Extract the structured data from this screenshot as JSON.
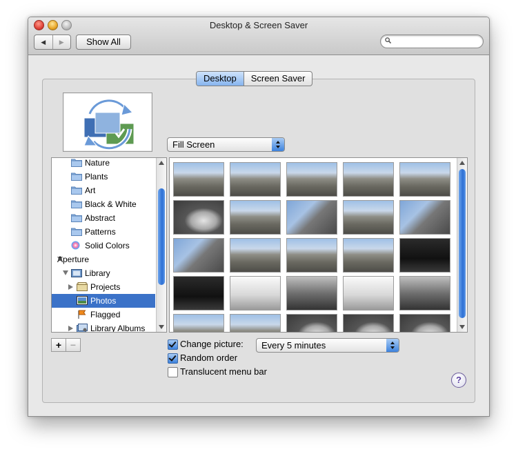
{
  "window": {
    "title": "Desktop & Screen Saver",
    "show_all": "Show All",
    "search_placeholder": "",
    "nav_back": "◀",
    "nav_forward": "▶"
  },
  "tabs": [
    {
      "label": "Desktop",
      "selected": true
    },
    {
      "label": "Screen Saver",
      "selected": false
    }
  ],
  "fit_popup": {
    "value": "Fill Screen"
  },
  "sidebar": {
    "items": [
      {
        "label": "Nature",
        "icon": "folder-icon",
        "indent": 1
      },
      {
        "label": "Plants",
        "icon": "folder-icon",
        "indent": 1
      },
      {
        "label": "Art",
        "icon": "folder-icon",
        "indent": 1
      },
      {
        "label": "Black & White",
        "icon": "folder-icon",
        "indent": 1
      },
      {
        "label": "Abstract",
        "icon": "folder-icon",
        "indent": 1
      },
      {
        "label": "Patterns",
        "icon": "folder-icon",
        "indent": 1
      },
      {
        "label": "Solid Colors",
        "icon": "color-wheel-icon",
        "indent": 1
      },
      {
        "label": "Aperture",
        "icon": "none",
        "indent": 0,
        "disclosure": "down"
      },
      {
        "label": "Library",
        "icon": "library-icon",
        "indent": 1,
        "disclosure": "down"
      },
      {
        "label": "Projects",
        "icon": "projects-icon",
        "indent": 2,
        "disclosure": "right"
      },
      {
        "label": "Photos",
        "icon": "photos-icon",
        "indent": 2,
        "selected": true
      },
      {
        "label": "Flagged",
        "icon": "flag-icon",
        "indent": 2
      },
      {
        "label": "Library Albums",
        "icon": "albums-icon",
        "indent": 2,
        "disclosure": "right"
      }
    ],
    "add_label": "+",
    "remove_label": "−"
  },
  "options": {
    "change_picture": {
      "label": "Change picture:",
      "checked": true
    },
    "interval": {
      "value": "Every 5 minutes"
    },
    "random_order": {
      "label": "Random order",
      "checked": true
    },
    "translucent_menu_bar": {
      "label": "Translucent menu bar",
      "checked": false
    }
  },
  "help_label": "?",
  "colors": {
    "selection": "#3b72c8",
    "accent": "#3d82dd"
  }
}
